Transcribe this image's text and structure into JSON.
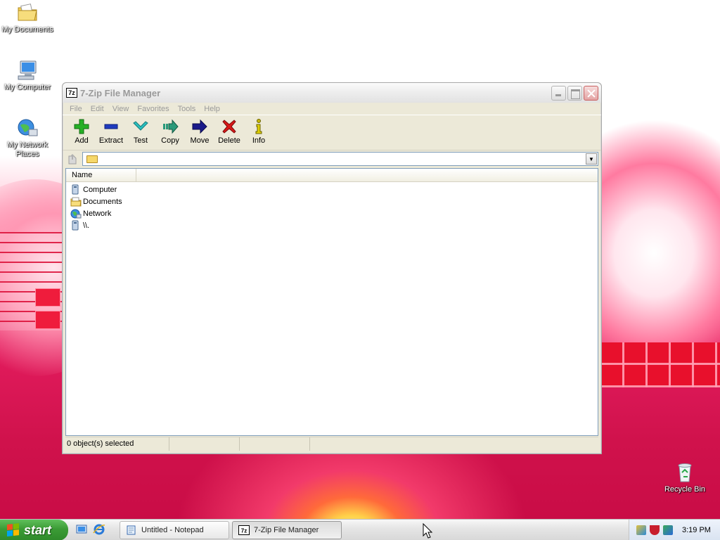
{
  "desktop": {
    "icons": [
      {
        "label": "My Documents",
        "icon": "folder-icon"
      },
      {
        "label": "My Computer",
        "icon": "computer-icon"
      },
      {
        "label": "My Network Places",
        "icon": "network-icon"
      },
      {
        "label": "Recycle Bin",
        "icon": "recycle-bin-icon"
      }
    ]
  },
  "window": {
    "title": "7-Zip File Manager",
    "app_icon_text": "7z",
    "menu": [
      "File",
      "Edit",
      "View",
      "Favorites",
      "Tools",
      "Help"
    ],
    "toolbar": [
      {
        "label": "Add",
        "icon": "plus-icon",
        "color": "#22aa22"
      },
      {
        "label": "Extract",
        "icon": "minus-icon",
        "color": "#1f3bbf"
      },
      {
        "label": "Test",
        "icon": "check-icon",
        "color": "#2bb8b8"
      },
      {
        "label": "Copy",
        "icon": "copy-arrow-icon",
        "color": "#2a9a7a"
      },
      {
        "label": "Move",
        "icon": "move-arrow-icon",
        "color": "#1a1a8a"
      },
      {
        "label": "Delete",
        "icon": "x-icon",
        "color": "#d01818"
      },
      {
        "label": "Info",
        "icon": "info-icon",
        "color": "#b5a800"
      }
    ],
    "address": {
      "value": ""
    },
    "list": {
      "columns": [
        "Name"
      ],
      "rows": [
        {
          "name": "Computer",
          "icon": "computer-icon"
        },
        {
          "name": "Documents",
          "icon": "folder-icon"
        },
        {
          "name": "Network",
          "icon": "network-icon"
        },
        {
          "name": "\\\\.",
          "icon": "drive-icon"
        }
      ]
    },
    "status": {
      "selected": "0 object(s) selected"
    }
  },
  "taskbar": {
    "start_label": "start",
    "tasks": [
      {
        "label": "Untitled - Notepad",
        "icon": "notepad-icon"
      },
      {
        "label": "7-Zip File Manager",
        "icon": "7zip-icon"
      }
    ],
    "clock": "3:19 PM"
  }
}
